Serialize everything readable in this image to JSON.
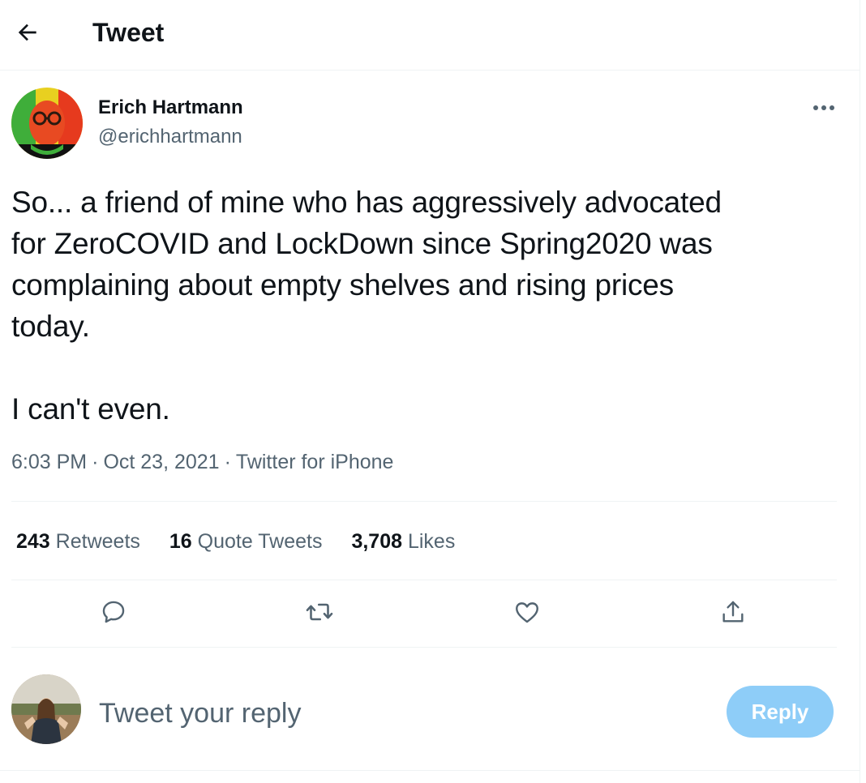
{
  "header": {
    "title": "Tweet",
    "back_icon": "arrow-left-icon"
  },
  "tweet": {
    "author": {
      "name": "Erich Hartmann",
      "handle": "@erichhartmann"
    },
    "text": "So... a friend of mine who has aggressively advocated\nfor ZeroCOVID and LockDown since Spring2020 was\ncomplaining about empty shelves and rising prices\ntoday.\n\nI can't even.",
    "time": "6:03 PM",
    "date": "Oct 23, 2021",
    "source": "Twitter for iPhone",
    "separator": "·",
    "stats": {
      "retweets_count": "243",
      "retweets_label": "Retweets",
      "quotes_count": "16",
      "quotes_label": "Quote Tweets",
      "likes_count": "3,708",
      "likes_label": "Likes"
    },
    "actions": [
      "reply-icon",
      "retweet-icon",
      "like-icon",
      "share-icon"
    ]
  },
  "composer": {
    "placeholder": "Tweet your reply",
    "reply_label": "Reply"
  },
  "colors": {
    "text": "#0f1419",
    "secondary": "#536471",
    "divider": "#eff3f4",
    "reply_button": "#8ecdf8"
  }
}
